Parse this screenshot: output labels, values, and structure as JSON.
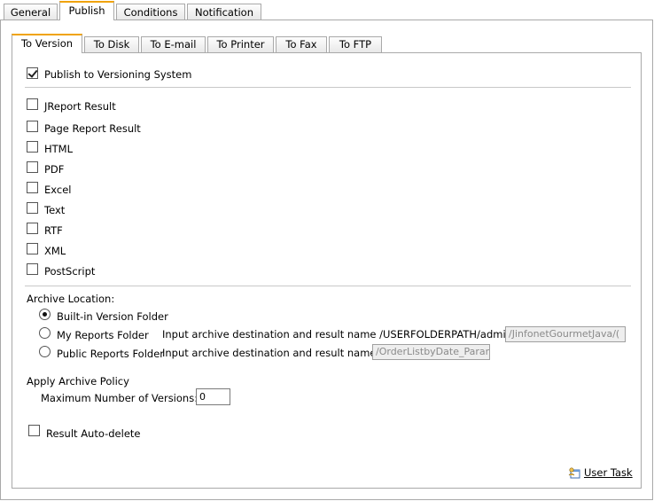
{
  "top_tabs": [
    {
      "label": "General",
      "active": false
    },
    {
      "label": "Publish",
      "active": true
    },
    {
      "label": "Conditions",
      "active": false
    },
    {
      "label": "Notification",
      "active": false
    }
  ],
  "sub_tabs": [
    {
      "label": "To Version",
      "active": true
    },
    {
      "label": "To Disk",
      "active": false
    },
    {
      "label": "To E-mail",
      "active": false
    },
    {
      "label": "To Printer",
      "active": false
    },
    {
      "label": "To Fax",
      "active": false
    },
    {
      "label": "To FTP",
      "active": false
    }
  ],
  "publish_to_versioning": {
    "label": "Publish to Versioning System",
    "checked": true
  },
  "formats": [
    {
      "label": "JReport Result",
      "checked": false
    },
    {
      "label": "Page Report Result",
      "checked": false
    },
    {
      "label": "HTML",
      "checked": false
    },
    {
      "label": "PDF",
      "checked": false
    },
    {
      "label": "Excel",
      "checked": false
    },
    {
      "label": "Text",
      "checked": false
    },
    {
      "label": "RTF",
      "checked": false
    },
    {
      "label": "XML",
      "checked": false
    },
    {
      "label": "PostScript",
      "checked": false
    }
  ],
  "archive": {
    "heading": "Archive Location:",
    "options": [
      {
        "label": "Built-in Version Folder",
        "selected": true
      },
      {
        "label": "My Reports Folder",
        "selected": false,
        "hint": "Input archive destination and result name /USERFOLDERPATH/admin",
        "value": "/JinfonetGourmetJava/("
      },
      {
        "label": "Public Reports Folder",
        "selected": false,
        "hint": "Input archive destination and result name",
        "value": "/OrderListbyDate_Paran"
      }
    ]
  },
  "policy": {
    "heading": "Apply Archive Policy",
    "max_versions_label": "Maximum Number of Versions:",
    "max_versions_value": "0"
  },
  "auto_delete": {
    "label": "Result Auto-delete",
    "checked": false
  },
  "user_task": {
    "label": "User Task",
    "icon": "user-task-icon"
  }
}
